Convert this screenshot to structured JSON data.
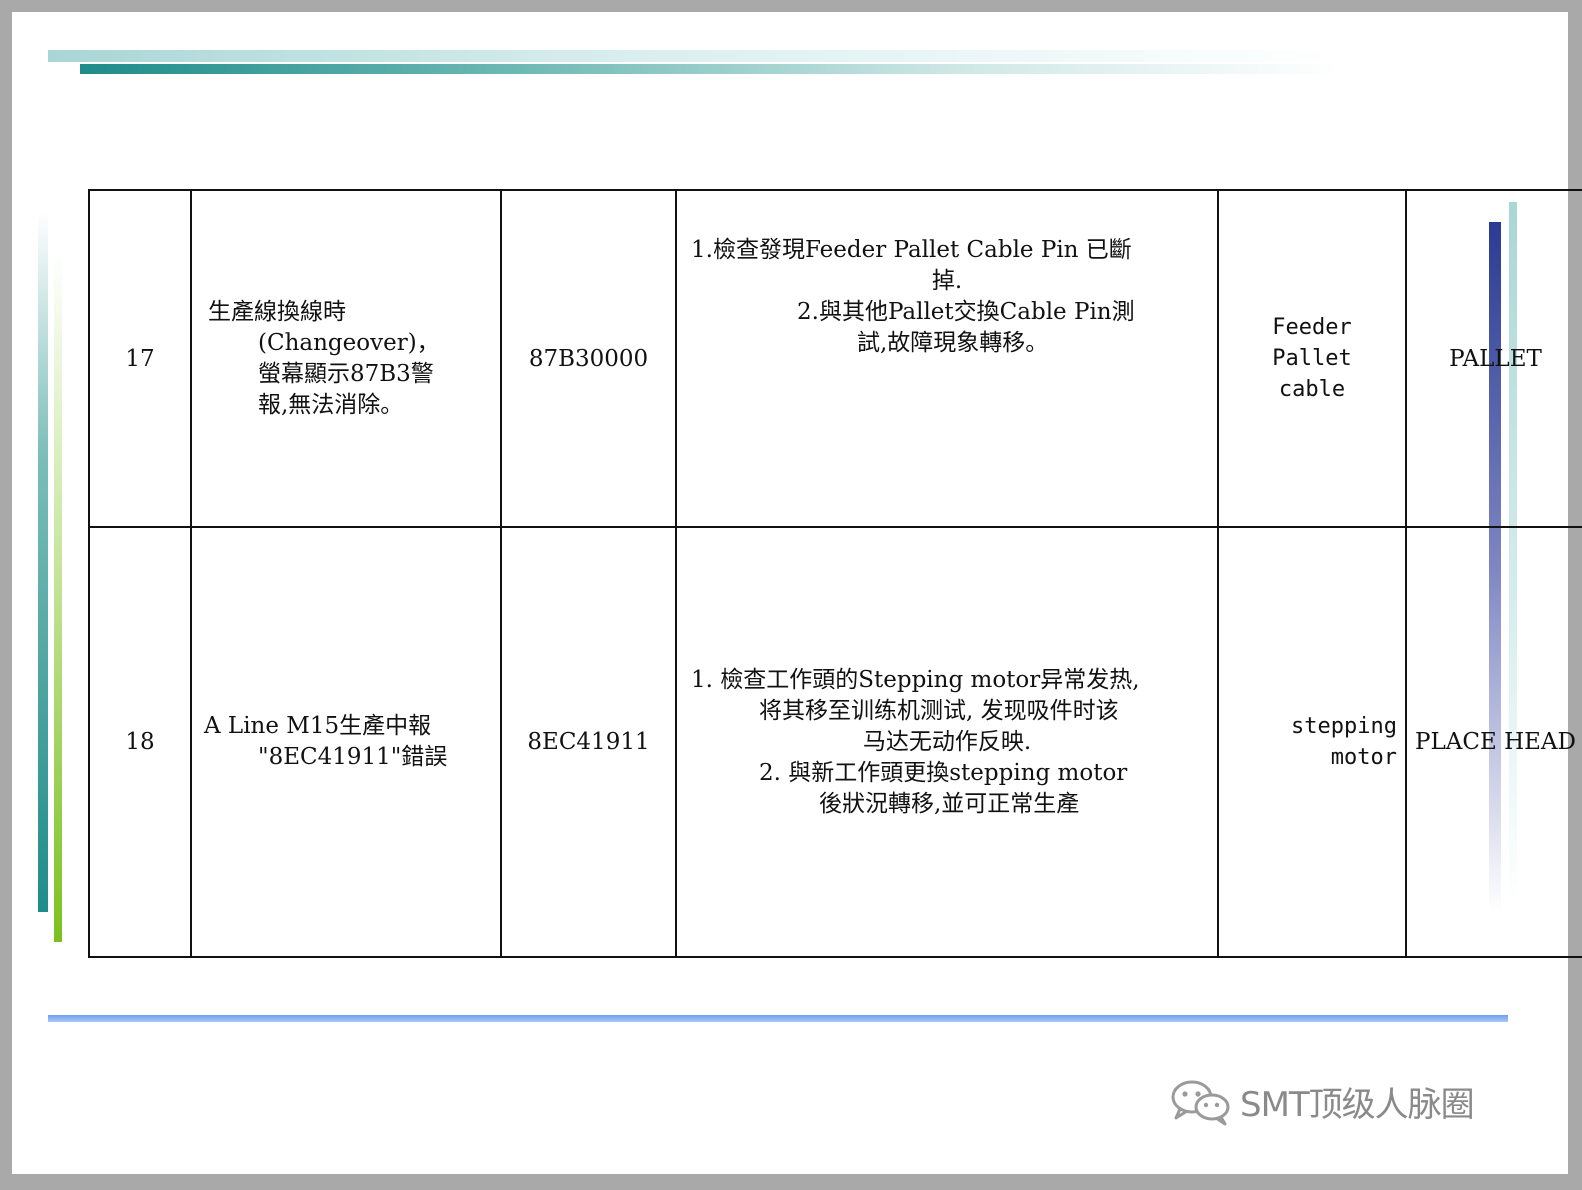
{
  "table": {
    "rows": [
      {
        "no": "17",
        "description_lines": [
          "生產線換線時",
          "(Changeover)，",
          "螢幕顯示87B3警",
          "報,無法消除。"
        ],
        "code": "87B30000",
        "action_lines": [
          "1.檢查發現Feeder Pallet Cable Pin 已斷",
          "掉.",
          "2.與其他Pallet交換Cable Pin測",
          "試,故障現象轉移。"
        ],
        "part_lines": [
          "Feeder",
          "Pallet",
          "cable"
        ],
        "category": "PALLET"
      },
      {
        "no": "18",
        "description_lines": [
          "A Line M15生產中報",
          "\"8EC41911\"錯誤"
        ],
        "code": "8EC41911",
        "action_lines": [
          "1.  檢查工作頭的Stepping motor异常发热,",
          "将其移至训练机测试, 发现吸件时该",
          "马达无动作反映.",
          "2.  與新工作頭更換stepping motor",
          "後狀況轉移,並可正常生產"
        ],
        "part_lines": [
          "stepping",
          "motor"
        ],
        "category": "PLACE HEAD"
      }
    ]
  },
  "watermark": {
    "text": "SMT顶级人脉圈",
    "icon": "wechat-icon"
  }
}
